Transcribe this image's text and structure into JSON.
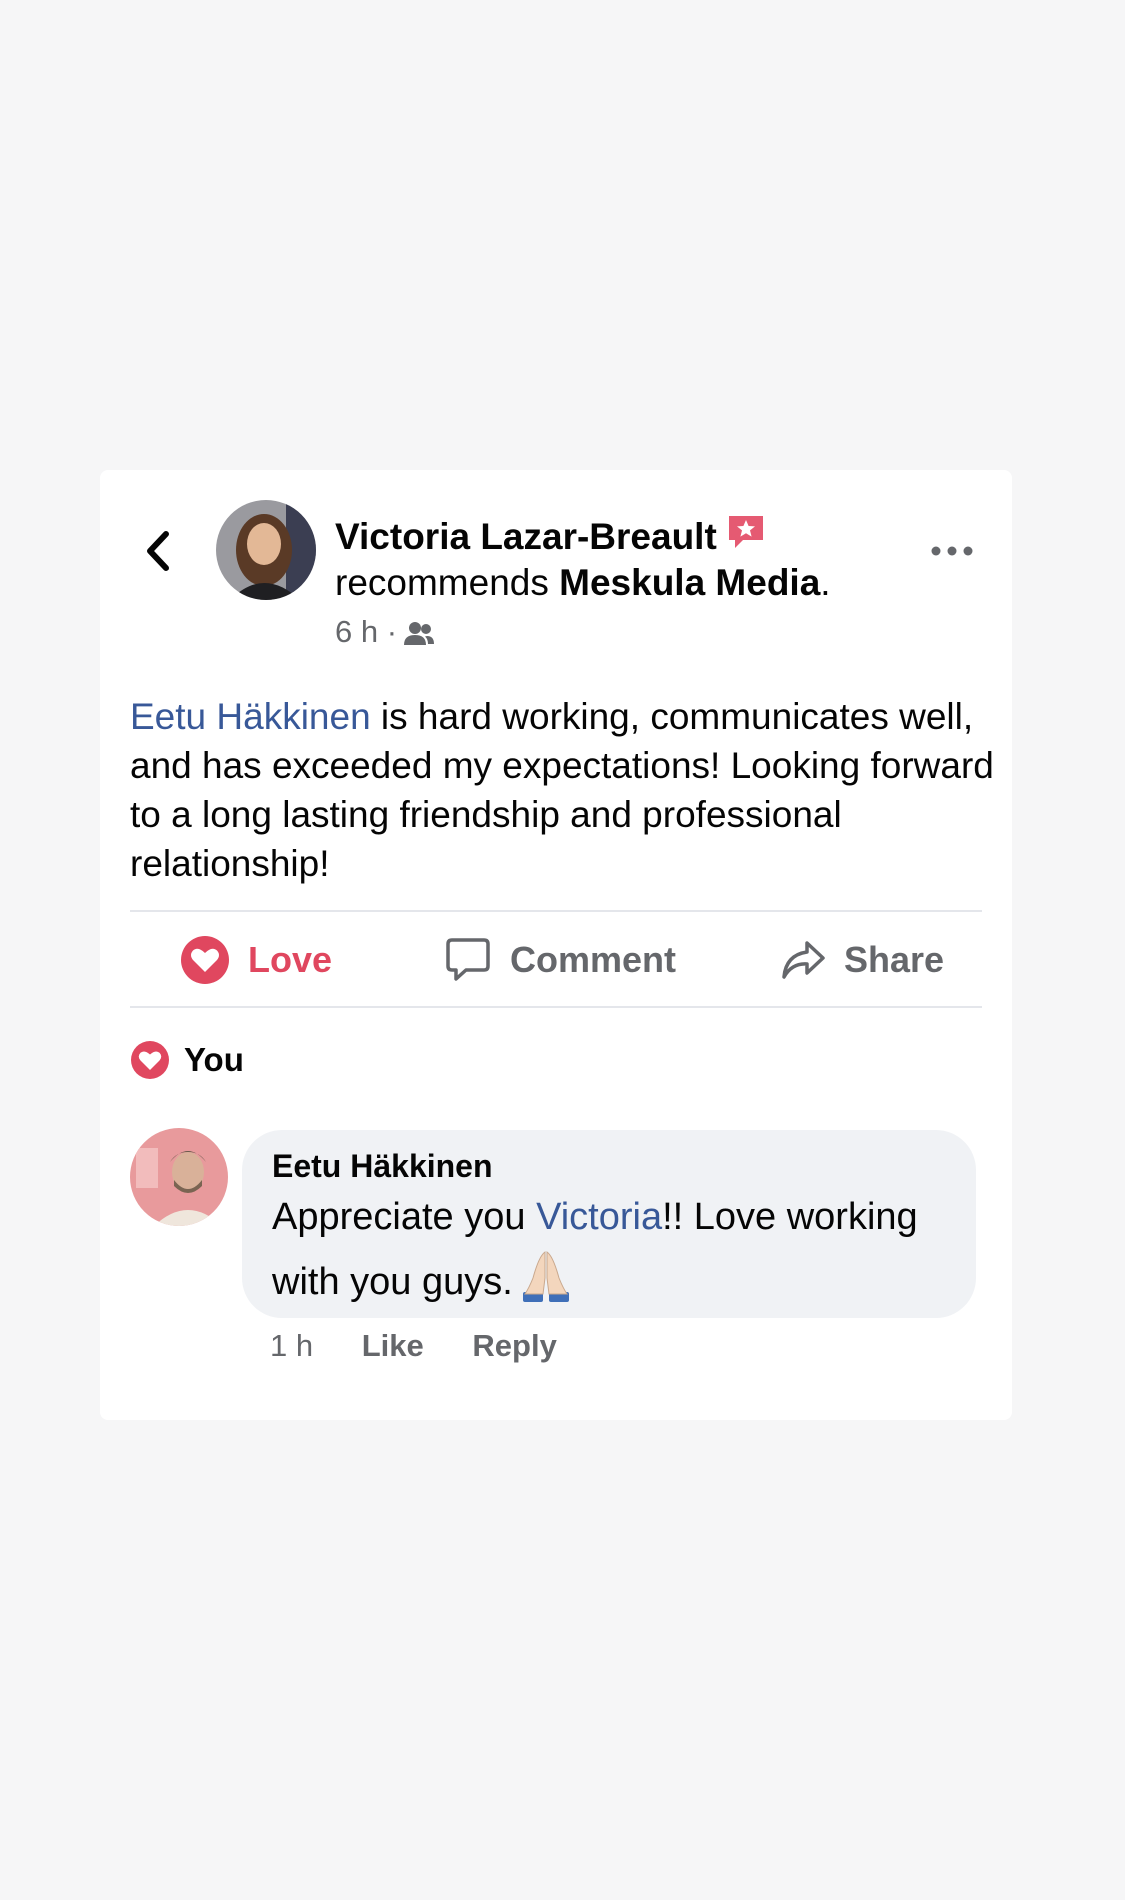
{
  "post": {
    "author": "Victoria Lazar-Breault",
    "recommends_prefix": "recommends",
    "page_name": "Meskula Media",
    "period": ".",
    "time": "6 h",
    "separator": "·",
    "audience_icon": "friends-icon",
    "text_mention": "Eetu Häkkinen",
    "text_body": " is hard working, communicates well, and has exceeded my expectations! Looking forward to a long lasting friendship and professional relationship!"
  },
  "actions": {
    "love_label": "Love",
    "comment_label": "Comment",
    "share_label": "Share"
  },
  "reactions": {
    "label": "You"
  },
  "comment": {
    "author": "Eetu Häkkinen",
    "text_prefix": "Appreciate you ",
    "text_mention": "Victoria",
    "text_suffix": "!! Love working with you guys.",
    "emoji": "folded-hands",
    "time": "1 h",
    "like_label": "Like",
    "reply_label": "Reply"
  },
  "colors": {
    "love": "#e0475f",
    "link": "#385898",
    "muted": "#65676b",
    "bubble": "#f0f2f5",
    "badge": "#e55a72"
  }
}
